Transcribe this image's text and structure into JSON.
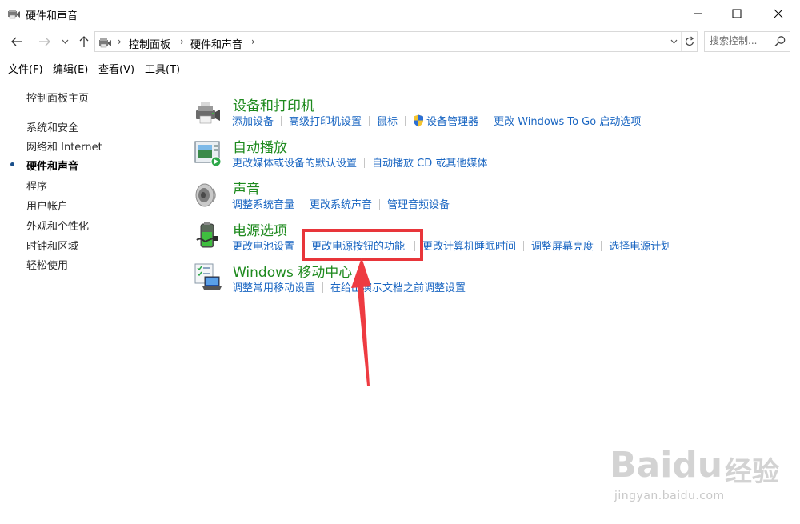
{
  "window": {
    "title": "硬件和声音",
    "minimize_icon": "minimize-icon",
    "maximize_icon": "maximize-icon",
    "close_icon": "close-icon"
  },
  "nav": {
    "back_icon": "arrow-left-icon",
    "forward_icon": "arrow-right-icon",
    "recent_icon": "chevron-down-icon",
    "up_icon": "arrow-up-icon"
  },
  "address": {
    "breadcrumbs": [
      "控制面板",
      "硬件和声音"
    ],
    "dropdown_icon": "chevron-down-icon",
    "refresh_icon": "refresh-icon"
  },
  "search": {
    "placeholder": "搜索控制..."
  },
  "menubar": {
    "items": [
      "文件(F)",
      "编辑(E)",
      "查看(V)",
      "工具(T)"
    ]
  },
  "leftnav": {
    "home": "控制面板主页",
    "items": [
      "系统和安全",
      "网络和 Internet",
      "硬件和声音",
      "程序",
      "用户帐户",
      "外观和个性化",
      "时钟和区域",
      "轻松使用"
    ],
    "current": "硬件和声音"
  },
  "categories": [
    {
      "title": "设备和打印机",
      "icon": "printer-icon",
      "links": [
        "添加设备",
        "高级打印机设置",
        "鼠标",
        "设备管理器",
        "更改 Windows To Go 启动选项"
      ]
    },
    {
      "title": "自动播放",
      "icon": "autoplay-icon",
      "links": [
        "更改媒体或设备的默认设置",
        "自动播放 CD 或其他媒体"
      ]
    },
    {
      "title": "声音",
      "icon": "speaker-icon",
      "links": [
        "调整系统音量",
        "更改系统声音",
        "管理音频设备"
      ]
    },
    {
      "title": "电源选项",
      "icon": "battery-icon",
      "links": [
        "更改电池设置",
        "更改电源按钮的功能",
        "更改计算机睡眠时间",
        "调整屏幕亮度",
        "选择电源计划"
      ]
    },
    {
      "title": "Windows 移动中心",
      "icon": "mobility-center-icon",
      "links": [
        "调整常用移动设置",
        "在给出演示文档之前调整设置"
      ]
    }
  ],
  "colors": {
    "category_title": "#1e8a1e",
    "link": "#1a66c2",
    "annotation": "#e8353a"
  },
  "watermark": {
    "brand": "Baidu",
    "cn": "经验",
    "url": "jingyan.baidu.com"
  }
}
